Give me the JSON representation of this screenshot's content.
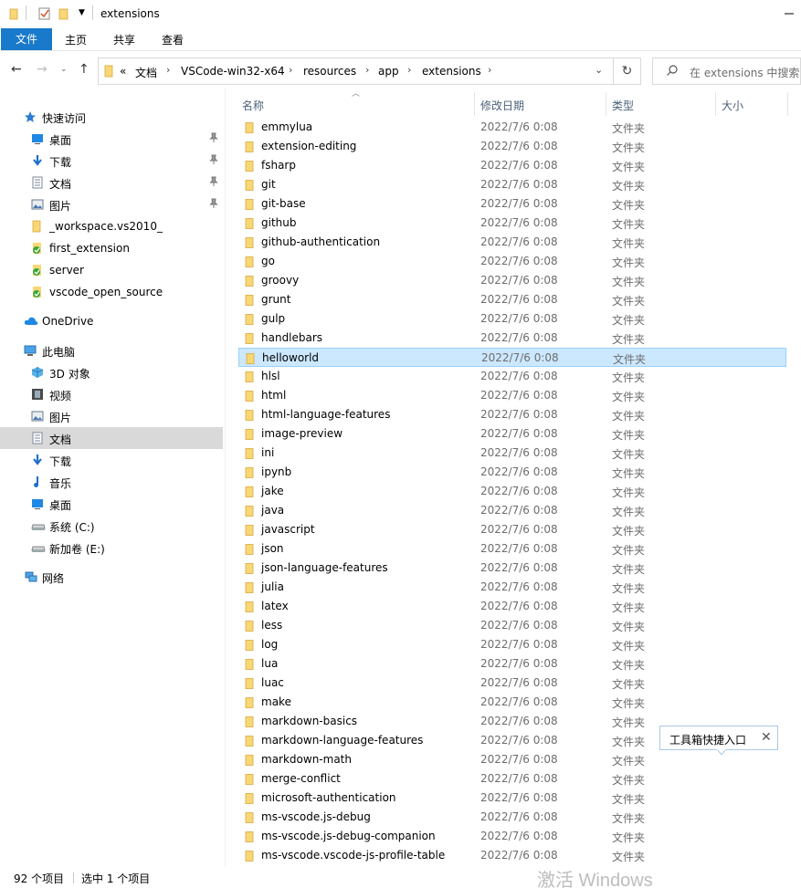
{
  "window": {
    "title": "extensions"
  },
  "ribbon": {
    "tabs": [
      "文件",
      "主页",
      "共享",
      "查看"
    ]
  },
  "address": {
    "crumbs": [
      "«",
      "文档",
      "VSCode-win32-x64",
      "resources",
      "app",
      "extensions"
    ]
  },
  "search": {
    "placeholder": "在 extensions 中搜索"
  },
  "sidebar": {
    "items": [
      {
        "label": "快速访问",
        "icon": "star-icon",
        "color": "#2b7cd3"
      },
      {
        "label": "桌面",
        "icon": "desktop-icon",
        "pinned": true
      },
      {
        "label": "下载",
        "icon": "download-icon",
        "pinned": true
      },
      {
        "label": "文档",
        "icon": "document-icon",
        "pinned": true
      },
      {
        "label": "图片",
        "icon": "pictures-icon",
        "pinned": true
      },
      {
        "label": "_workspace.vs2010_",
        "icon": "folder-icon"
      },
      {
        "label": "first_extension",
        "icon": "git-folder-icon"
      },
      {
        "label": "server",
        "icon": "git-folder-icon"
      },
      {
        "label": "vscode_open_source",
        "icon": "git-folder-icon"
      },
      {
        "label": "OneDrive",
        "icon": "cloud-icon"
      },
      {
        "label": "此电脑",
        "icon": "computer-icon"
      },
      {
        "label": "3D 对象",
        "icon": "3d-objects-icon"
      },
      {
        "label": "视频",
        "icon": "video-icon"
      },
      {
        "label": "图片",
        "icon": "pictures-icon"
      },
      {
        "label": "文档",
        "icon": "document-icon",
        "selected": true
      },
      {
        "label": "下载",
        "icon": "download-icon"
      },
      {
        "label": "音乐",
        "icon": "music-icon"
      },
      {
        "label": "桌面",
        "icon": "desktop-icon"
      },
      {
        "label": "系统 (C:)",
        "icon": "drive-icon"
      },
      {
        "label": "新加卷 (E:)",
        "icon": "drive-icon"
      },
      {
        "label": "网络",
        "icon": "network-icon"
      }
    ]
  },
  "columns": {
    "name": "名称",
    "date": "修改日期",
    "type": "类型",
    "size": "大小"
  },
  "files": [
    {
      "name": "emmylua",
      "date": "2022/7/6 0:08",
      "type": "文件夹"
    },
    {
      "name": "extension-editing",
      "date": "2022/7/6 0:08",
      "type": "文件夹"
    },
    {
      "name": "fsharp",
      "date": "2022/7/6 0:08",
      "type": "文件夹"
    },
    {
      "name": "git",
      "date": "2022/7/6 0:08",
      "type": "文件夹"
    },
    {
      "name": "git-base",
      "date": "2022/7/6 0:08",
      "type": "文件夹"
    },
    {
      "name": "github",
      "date": "2022/7/6 0:08",
      "type": "文件夹"
    },
    {
      "name": "github-authentication",
      "date": "2022/7/6 0:08",
      "type": "文件夹"
    },
    {
      "name": "go",
      "date": "2022/7/6 0:08",
      "type": "文件夹"
    },
    {
      "name": "groovy",
      "date": "2022/7/6 0:08",
      "type": "文件夹"
    },
    {
      "name": "grunt",
      "date": "2022/7/6 0:08",
      "type": "文件夹"
    },
    {
      "name": "gulp",
      "date": "2022/7/6 0:08",
      "type": "文件夹"
    },
    {
      "name": "handlebars",
      "date": "2022/7/6 0:08",
      "type": "文件夹"
    },
    {
      "name": "helloworld",
      "date": "2022/7/6 0:08",
      "type": "文件夹",
      "selected": true
    },
    {
      "name": "hlsl",
      "date": "2022/7/6 0:08",
      "type": "文件夹"
    },
    {
      "name": "html",
      "date": "2022/7/6 0:08",
      "type": "文件夹"
    },
    {
      "name": "html-language-features",
      "date": "2022/7/6 0:08",
      "type": "文件夹"
    },
    {
      "name": "image-preview",
      "date": "2022/7/6 0:08",
      "type": "文件夹"
    },
    {
      "name": "ini",
      "date": "2022/7/6 0:08",
      "type": "文件夹"
    },
    {
      "name": "ipynb",
      "date": "2022/7/6 0:08",
      "type": "文件夹"
    },
    {
      "name": "jake",
      "date": "2022/7/6 0:08",
      "type": "文件夹"
    },
    {
      "name": "java",
      "date": "2022/7/6 0:08",
      "type": "文件夹"
    },
    {
      "name": "javascript",
      "date": "2022/7/6 0:08",
      "type": "文件夹"
    },
    {
      "name": "json",
      "date": "2022/7/6 0:08",
      "type": "文件夹"
    },
    {
      "name": "json-language-features",
      "date": "2022/7/6 0:08",
      "type": "文件夹"
    },
    {
      "name": "julia",
      "date": "2022/7/6 0:08",
      "type": "文件夹"
    },
    {
      "name": "latex",
      "date": "2022/7/6 0:08",
      "type": "文件夹"
    },
    {
      "name": "less",
      "date": "2022/7/6 0:08",
      "type": "文件夹"
    },
    {
      "name": "log",
      "date": "2022/7/6 0:08",
      "type": "文件夹"
    },
    {
      "name": "lua",
      "date": "2022/7/6 0:08",
      "type": "文件夹"
    },
    {
      "name": "luac",
      "date": "2022/7/6 0:08",
      "type": "文件夹"
    },
    {
      "name": "make",
      "date": "2022/7/6 0:08",
      "type": "文件夹"
    },
    {
      "name": "markdown-basics",
      "date": "2022/7/6 0:08",
      "type": "文件夹"
    },
    {
      "name": "markdown-language-features",
      "date": "2022/7/6 0:08",
      "type": "文件夹"
    },
    {
      "name": "markdown-math",
      "date": "2022/7/6 0:08",
      "type": "文件夹"
    },
    {
      "name": "merge-conflict",
      "date": "2022/7/6 0:08",
      "type": "文件夹"
    },
    {
      "name": "microsoft-authentication",
      "date": "2022/7/6 0:08",
      "type": "文件夹"
    },
    {
      "name": "ms-vscode.js-debug",
      "date": "2022/7/6 0:08",
      "type": "文件夹"
    },
    {
      "name": "ms-vscode.js-debug-companion",
      "date": "2022/7/6 0:08",
      "type": "文件夹"
    },
    {
      "name": "ms-vscode.vscode-js-profile-table",
      "date": "2022/7/6 0:08",
      "type": "文件夹"
    }
  ],
  "tooltip": {
    "text": "工具箱快捷入口"
  },
  "status": {
    "count": "92 个项目",
    "selection": "选中 1 个项目",
    "watermark": "激活 Windows"
  },
  "colors": {
    "accent": "#1979ca",
    "selection": "#cce8ff",
    "folder": "#f8d775"
  }
}
